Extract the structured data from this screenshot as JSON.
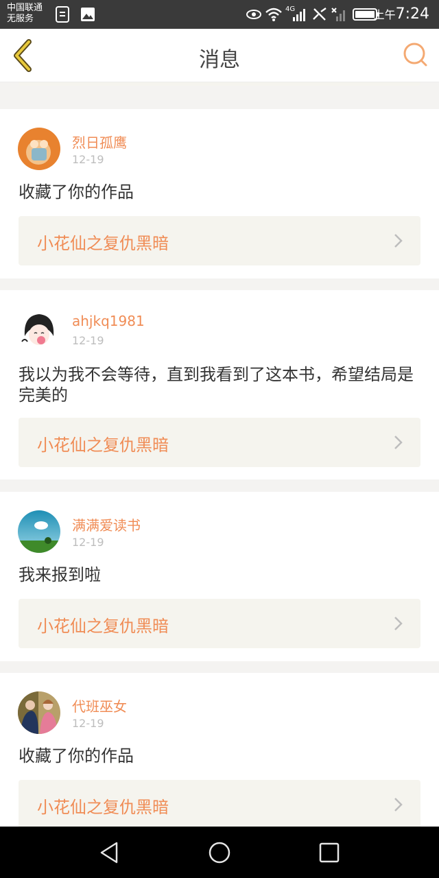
{
  "status_bar": {
    "carrier_line1": "中国联通",
    "carrier_line2": "无服务",
    "time_prefix": "上午",
    "time": "7:24",
    "network": "4G"
  },
  "header": {
    "title": "消息",
    "back_icon": "back-chevron-icon",
    "search_icon": "search-icon"
  },
  "messages": [
    {
      "user": "烈日孤鹰",
      "date": "12-19",
      "text": "收藏了你的作品",
      "book": "小花仙之复仇黑暗"
    },
    {
      "user": "ahjkq1981",
      "date": "12-19",
      "text": "我以为我不会等待，直到我看到了这本书，希望结局是完美的",
      "book": "小花仙之复仇黑暗"
    },
    {
      "user": "满满爱读书",
      "date": "12-19",
      "text": "我来报到啦",
      "book": "小花仙之复仇黑暗"
    },
    {
      "user": "代班巫女",
      "date": "12-19",
      "text": "收藏了你的作品",
      "book": "小花仙之复仇黑暗"
    }
  ],
  "colors": {
    "accent": "#f08c55",
    "header_icon": "#f4a972",
    "back_icon": "#e8c93c"
  }
}
